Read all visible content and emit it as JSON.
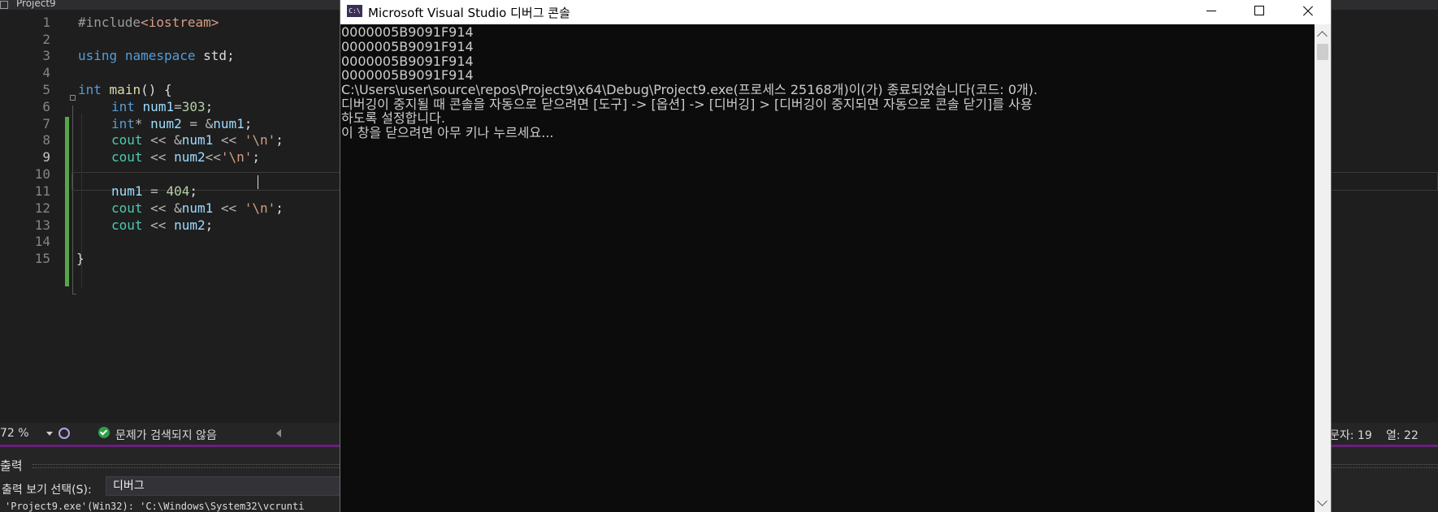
{
  "ide": {
    "title": "Project9",
    "code": {
      "line_numbers": [
        "1",
        "2",
        "3",
        "4",
        "5",
        "6",
        "7",
        "8",
        "9",
        "10",
        "11",
        "12",
        "13",
        "14",
        "15"
      ],
      "l1": {
        "directive": "#include",
        "header": "<iostream>"
      },
      "l3": {
        "kw1": "using",
        "kw2": "namespace",
        "name": "std",
        "semi": ";"
      },
      "l5": {
        "type": "int",
        "func": "main",
        "rest": "() {"
      },
      "l6": {
        "type": "int",
        "var": "num1",
        "op": "=",
        "num": "303",
        "semi": ";"
      },
      "l7": {
        "type": "int",
        "ptr": "* ",
        "var": "num2",
        "op": " = &",
        "ref": "num1",
        "semi": ";"
      },
      "l8": {
        "obj": "cout",
        "op1": " << &",
        "var": "num1",
        "op2": " << ",
        "str": "'\\n'",
        "semi": ";"
      },
      "l9": {
        "obj": "cout",
        "op1": " << ",
        "var": "num2",
        "op2": "<<",
        "str": "'\\n'",
        "semi": ";"
      },
      "l11": {
        "var": "num1",
        "op": " = ",
        "num": "404",
        "semi": ";"
      },
      "l12": {
        "obj": "cout",
        "op1": " << &",
        "var": "num1",
        "op2": " << ",
        "str": "'\\n'",
        "semi": ";"
      },
      "l13": {
        "obj": "cout",
        "op1": " << ",
        "var": "num2",
        "semi": ";"
      },
      "l15": {
        "brace": "}"
      }
    },
    "status": {
      "zoom": "72 %",
      "issues": "문제가 검색되지 않음",
      "char_pos": "문자: 19",
      "col_pos": "열: 22"
    },
    "output": {
      "title": "출력",
      "source_label": "출력 보기 선택(S):",
      "source_value": "디버그",
      "log_line": "'Project9.exe'(Win32): 'C:\\Windows\\System32\\vcrunti"
    }
  },
  "console": {
    "title": "Microsoft Visual Studio 디버그 콘솔",
    "icon_text": "C:\\",
    "lines": [
      "0000005B9091F914",
      "0000005B9091F914",
      "0000005B9091F914",
      "0000005B9091F914",
      "C:\\Users\\user\\source\\repos\\Project9\\x64\\Debug\\Project9.exe(프로세스 25168개)이(가) 종료되었습니다(코드: 0개).",
      "디버깅이 중지될 때 콘솔을 자동으로 닫으려면 [도구] -> [옵션] -> [디버깅] > [디버깅이 중지되면 자동으로 콘솔 닫기]를 사용",
      "하도록 설정합니다.",
      "이 창을 닫으려면 아무 키나 누르세요..."
    ]
  },
  "colors": {
    "keyword": "#569cd6",
    "variable": "#9cdcfe",
    "string": "#d69d85",
    "number": "#b5cea8",
    "change_bar": "#57a64a",
    "accent": "#68217a"
  }
}
